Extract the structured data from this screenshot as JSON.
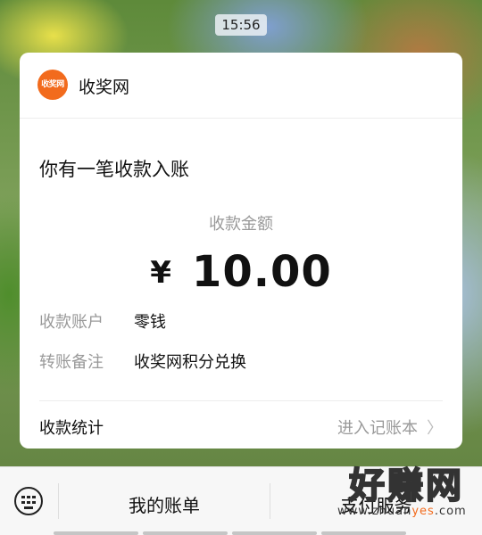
{
  "status_bar": {
    "time": "15:56"
  },
  "notification": {
    "app_logo_text": "收奖网",
    "app_name": "收奖网",
    "headline": "你有一笔收款入账",
    "amount_label": "收款金额",
    "currency": "¥",
    "amount": "10.00",
    "details": [
      {
        "key": "收款账户",
        "value": "零钱"
      },
      {
        "key": "转账备注",
        "value": "收奖网积分兑换"
      }
    ],
    "stats_label": "收款统计",
    "ledger_link": "进入记账本"
  },
  "bottom_bar": {
    "tabs": [
      "我的账单",
      "支付服务"
    ]
  },
  "watermark": {
    "text": "好赚网",
    "url_pre": "www.zhuan",
    "url_mid": "yes",
    "url_post": ".com"
  },
  "colors": {
    "brand": "#f26b1d",
    "muted": "#999999"
  }
}
